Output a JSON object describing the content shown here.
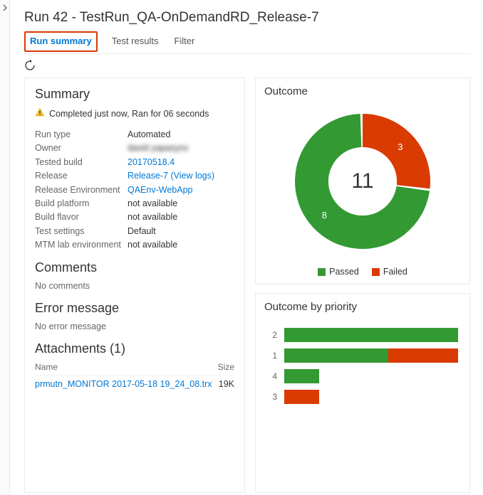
{
  "colors": {
    "pass": "#339933",
    "fail": "#da3b01",
    "link": "#0078d4"
  },
  "header": {
    "title": "Run 42 - TestRun_QA-OnDemandRD_Release-7",
    "tabs": [
      {
        "label": "Run summary",
        "active": true
      },
      {
        "label": "Test results",
        "active": false
      },
      {
        "label": "Filter",
        "active": false
      }
    ]
  },
  "summary": {
    "heading": "Summary",
    "status": "Completed just now, Ran for 06 seconds",
    "fields": {
      "run_type": {
        "label": "Run type",
        "value": "Automated"
      },
      "owner": {
        "label": "Owner",
        "value": "david yapasync"
      },
      "tested_build": {
        "label": "Tested build",
        "value": "20170518.4",
        "link": true
      },
      "release": {
        "label": "Release",
        "value": "Release-7 (View logs)",
        "link": true
      },
      "release_env": {
        "label": "Release Environment",
        "value": "QAEnv-WebApp",
        "link": true
      },
      "build_platform": {
        "label": "Build platform",
        "value": "not available"
      },
      "build_flavor": {
        "label": "Build flavor",
        "value": "not available"
      },
      "test_settings": {
        "label": "Test settings",
        "value": "Default"
      },
      "mtm": {
        "label": "MTM lab environment",
        "value": "not available"
      }
    },
    "comments": {
      "heading": "Comments",
      "text": "No comments"
    },
    "error": {
      "heading": "Error message",
      "text": "No error message"
    },
    "attachments": {
      "heading": "Attachments (1)",
      "col_name": "Name",
      "col_size": "Size",
      "items": [
        {
          "name": "prmutn_MONITOR 2017-05-18 19_24_08.trx",
          "size": "19K"
        }
      ]
    }
  },
  "chart_data": [
    {
      "type": "pie",
      "title": "Outcome",
      "total": 11,
      "series": [
        {
          "name": "Passed",
          "value": 8,
          "color": "#339933"
        },
        {
          "name": "Failed",
          "value": 3,
          "color": "#da3b01"
        }
      ],
      "legend": [
        "Passed",
        "Failed"
      ]
    },
    {
      "type": "bar",
      "title": "Outcome by priority",
      "categories": [
        "2",
        "1",
        "4",
        "3"
      ],
      "series": [
        {
          "name": "Passed",
          "values": [
            5,
            3,
            1,
            0
          ],
          "color": "#339933"
        },
        {
          "name": "Failed",
          "values": [
            0,
            2,
            0,
            1
          ],
          "color": "#da3b01"
        }
      ],
      "xlim": [
        0,
        5
      ]
    }
  ]
}
